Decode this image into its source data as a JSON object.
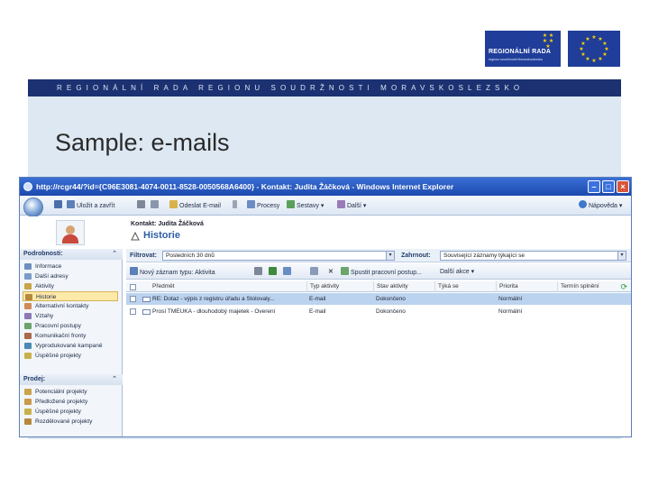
{
  "slide": {
    "band_text": "REGIONÁLNÍ RADA REGIONU SOUDRŽNOSTI MORAVSKOSLEZSKO",
    "title": "Sample: e-mails",
    "logo_text": "REGIONÁLNÍ RADA",
    "logo_subtext": "regionu soudržnosti Moravskoslezsko"
  },
  "window": {
    "title": "http://rcgr44/?id={C96E3081-4074-0011-8528-0050568A6400} - Kontakt: Judita Žáčková - Windows Internet Explorer",
    "toolbar": {
      "save_close": "Uložit a zavřít",
      "send_email": "Odeslat E-mail",
      "process": "Procesy",
      "reports": "Sestavy",
      "more": "Další",
      "help": "Nápověda"
    }
  },
  "header": {
    "contact_name": "Kontakt: Judita Žáčková",
    "heading": "Historie"
  },
  "sidebar": {
    "details_title": "Podrobnosti:",
    "details_items": [
      "Informace",
      "Další adresy",
      "Aktivity",
      "Historie",
      "Alternativní kontakty",
      "Vztahy",
      "Pracovní postupy",
      "Komunikační fronty",
      "Vyprodukované kampaně",
      "Úspěšné projekty"
    ],
    "sales_title": "Prodej:",
    "sales_items": [
      "Potenciální projekty",
      "Předložené projekty",
      "Úspěšné projekty",
      "Rozdělované projekty"
    ]
  },
  "filter": {
    "label": "Filtrovat:",
    "value": "Posledních 30 dnů",
    "include_label": "Zahrnout:",
    "include_value": "Související záznamy týkající se"
  },
  "grid_toolbar": {
    "new_activity": "Nový záznam typu: Aktivita",
    "run_workflow": "Spustit pracovní postup...",
    "more_actions": "Další akce"
  },
  "columns": [
    "Předmět",
    "Typ aktivity",
    "Stav aktivity",
    "Týká se",
    "Priorita",
    "Termín splnění"
  ],
  "rows": [
    {
      "subject": "RE: Dotaz - výpis z registru úřadu a Stolovaly...",
      "type": "E-mail",
      "status": "Dokončeno",
      "regarding": "",
      "priority": "Normální",
      "due": ""
    },
    {
      "subject": "Prosí TMEUKA - dlouhodobý majetek - Overení",
      "type": "E-mail",
      "status": "Dokončeno",
      "regarding": "",
      "priority": "Normální",
      "due": ""
    }
  ]
}
